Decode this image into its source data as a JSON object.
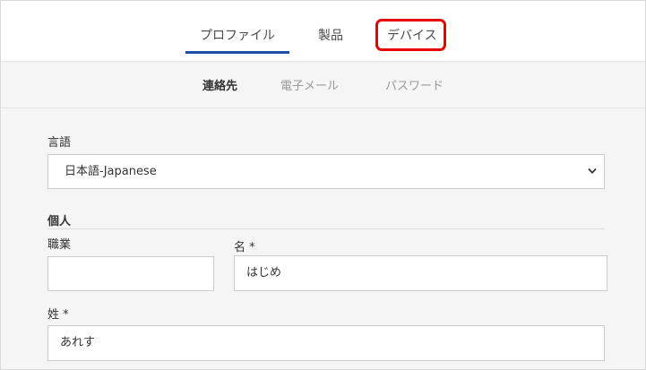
{
  "top_tabs": {
    "profile": "プロファイル",
    "products": "製品",
    "devices": "デバイス"
  },
  "sub_tabs": {
    "contact": "連絡先",
    "email": "電子メール",
    "password": "パスワード"
  },
  "form": {
    "language_label": "言語",
    "language_value": "日本語-Japanese",
    "personal_section": "個人",
    "job_title_label": "職業",
    "job_title_value": "",
    "first_name_label": "名 *",
    "first_name_value": "はじめ",
    "last_name_label": "姓 *",
    "last_name_value": "あれす"
  },
  "colors": {
    "active_tab_underline": "#1a4fa8",
    "highlight": "#e60000"
  },
  "icons": {
    "select_arrow": "chevron-down-icon"
  }
}
